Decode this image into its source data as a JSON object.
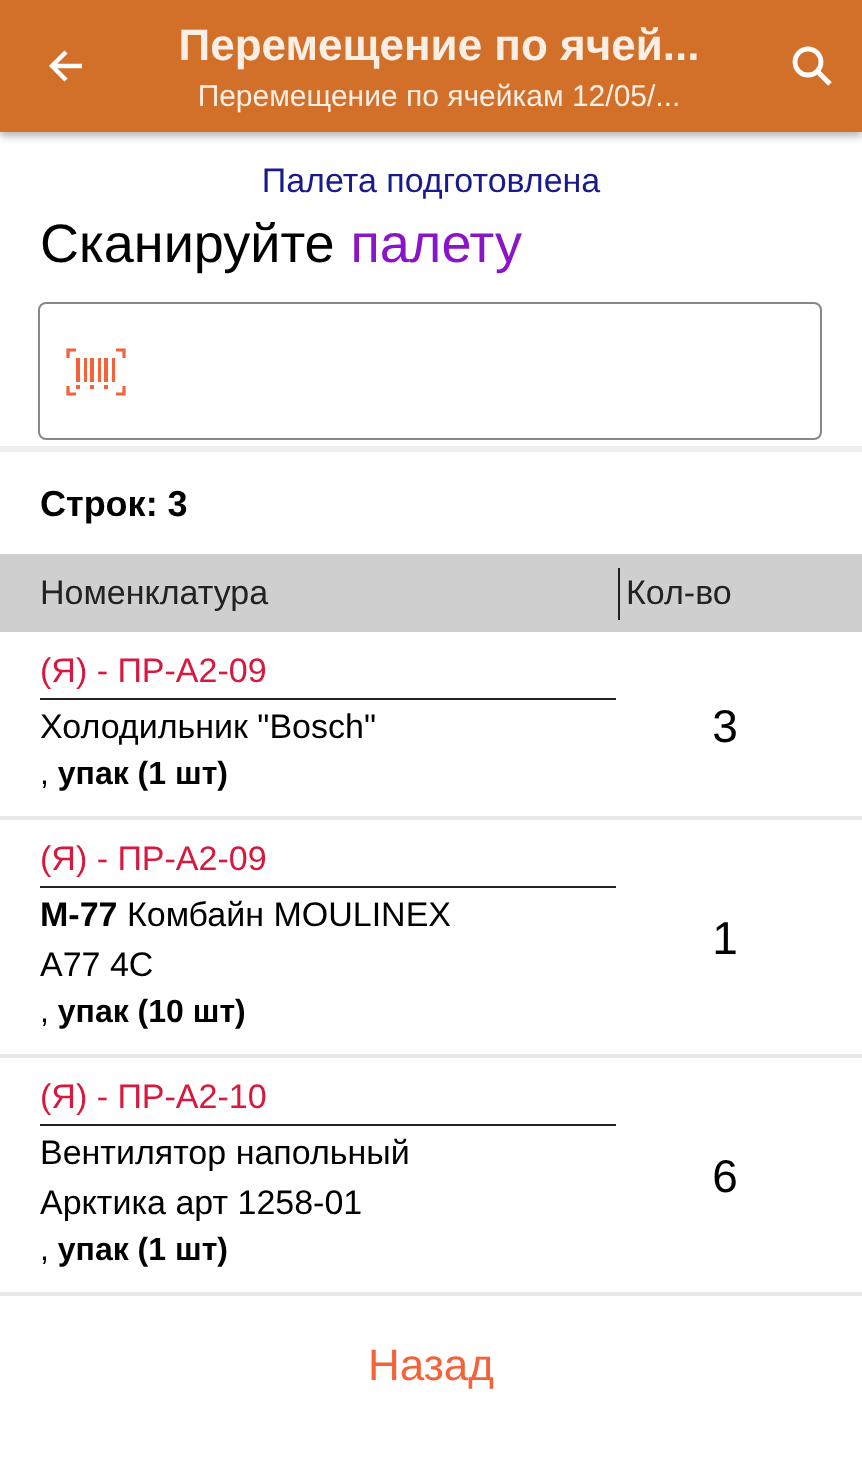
{
  "app_bar": {
    "title": "Перемещение по ячей...",
    "subtitle": "Перемещение по ячейкам 12/05/..."
  },
  "status": "Палета подготовлена",
  "prompt": {
    "text": "Сканируйте",
    "target": "палету"
  },
  "row_count": "Строк: 3",
  "table": {
    "columns": [
      "Номенклатура",
      "Кол-во"
    ],
    "rows": [
      {
        "cell": "(Я) - ПР-А2-09",
        "name": "Холодильник \"Bosch\"",
        "pack": ", **упак (1 шт)**",
        "qty": "3"
      },
      {
        "cell": "(Я) - ПР-А2-09",
        "name": "**М-77** Комбайн MOULINEX A77 4C",
        "pack": ", **упак (10 шт)**",
        "qty": "1"
      },
      {
        "cell": "(Я) - ПР-А2-10",
        "name": "Вентилятор напольный Арктика арт 1258-01",
        "pack": ", **упак (1 шт)**",
        "qty": "6"
      }
    ]
  },
  "back_button": "Назад"
}
